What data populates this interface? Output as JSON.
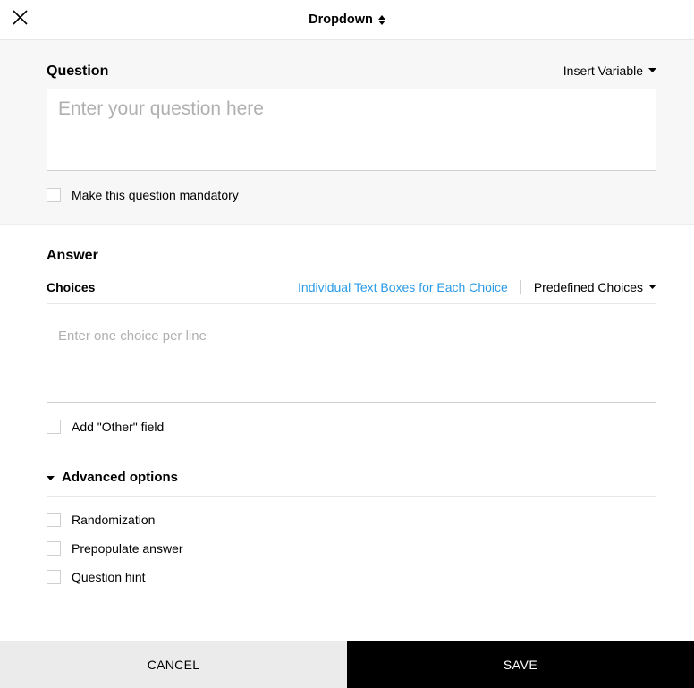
{
  "header": {
    "title": "Dropdown"
  },
  "question": {
    "label": "Question",
    "insert_variable_label": "Insert Variable",
    "placeholder": "Enter your question here",
    "value": "",
    "mandatory_label": "Make this question mandatory"
  },
  "answer": {
    "label": "Answer",
    "choices_label": "Choices",
    "individual_textboxes_label": "Individual Text Boxes for Each Choice",
    "predefined_choices_label": "Predefined Choices",
    "choices_placeholder": "Enter one choice per line",
    "choices_value": "",
    "add_other_label": "Add \"Other\" field"
  },
  "advanced": {
    "header": "Advanced options",
    "options": [
      {
        "label": "Randomization"
      },
      {
        "label": "Prepopulate answer"
      },
      {
        "label": "Question hint"
      }
    ]
  },
  "footer": {
    "cancel": "CANCEL",
    "save": "SAVE"
  }
}
